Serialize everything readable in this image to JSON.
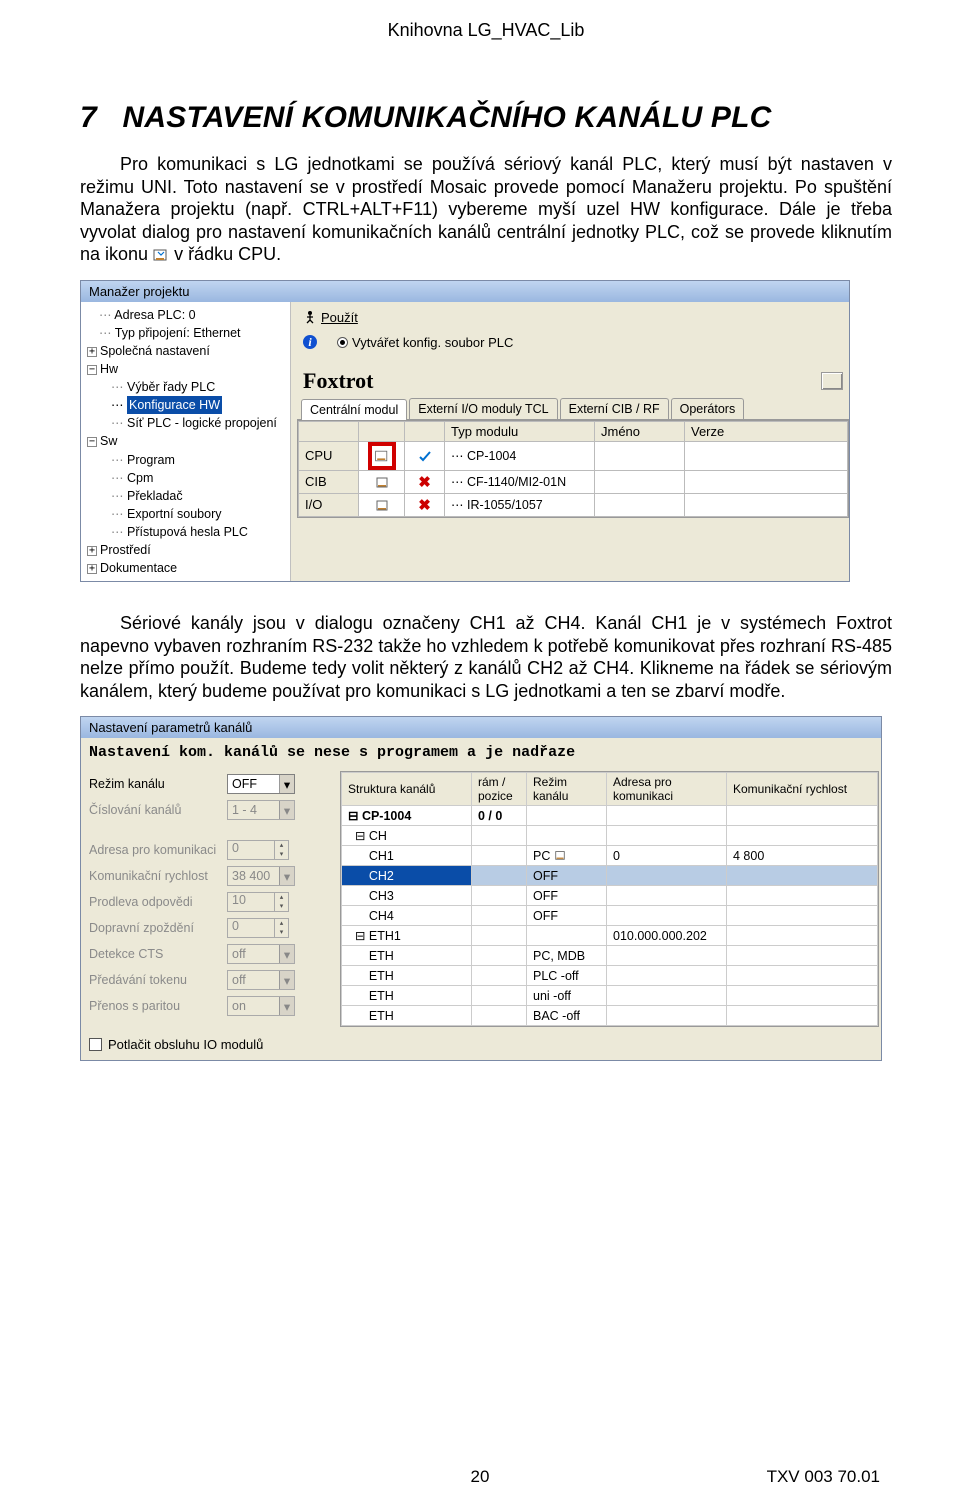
{
  "header": {
    "library_name": "Knihovna LG_HVAC_Lib"
  },
  "section": {
    "number": "7",
    "title": "NASTAVENÍ KOMUNIKAČNÍHO KANÁLU PLC",
    "p1": "Pro komunikaci s LG jednotkami se používá sériový kanál PLC, který musí být nastaven v režimu UNI. Toto nastavení se v prostředí Mosaic provede pomocí Manažeru projektu. Po spuštění Manažera projektu (např. CTRL+ALT+F11) vybereme myší uzel HW konfigurace. Dále je třeba vyvolat dialog pro nastavení komunikačních kanálů centrální jednotky PLC, což se provede kliknutím  na  ikonu ",
    "p1_after_icon": " v řádku CPU.",
    "p2": "Sériové kanály jsou v dialogu označeny CH1 až CH4. Kanál CH1 je v systémech Foxtrot napevno vybaven rozhraním RS-232 takže ho vzhledem k potřebě komunikovat přes rozhraní RS-485 nelze přímo použít. Budeme tedy volit některý z kanálů CH2 až CH4. Klikneme na řádek se sériovým kanálem, který budeme používat pro komunikaci s LG jednotkami a ten se zbarví modře."
  },
  "fig1": {
    "title": "Manažer projektu",
    "tree": {
      "addr": "Adresa PLC: 0",
      "conn": "Typ připojení: Ethernet",
      "common": "Společná nastavení",
      "hw": "Hw",
      "hw_sel": "Výběr řady PLC",
      "hw_konf": "Konfigurace HW",
      "hw_net": "Síť PLC - logické propojení",
      "sw": "Sw",
      "sw_prog": "Program",
      "sw_cpm": "Cpm",
      "sw_comp": "Překladač",
      "sw_exp": "Exportní soubory",
      "sw_pw": "Přístupová hesla PLC",
      "env": "Prostředí",
      "doc": "Dokumentace"
    },
    "toolbar": {
      "use_label": "Použít",
      "create_label": "Vytvářet konfig. soubor PLC"
    },
    "foxtrot_title": "Foxtrot",
    "tabs": [
      "Centrální modul",
      "Externí I/O moduly TCL",
      "Externí CIB / RF",
      "Operátors"
    ],
    "modtable": {
      "headers": {
        "blank": "",
        "typ": "Typ modulu",
        "jmeno": "Jméno",
        "verze": "Verze"
      },
      "rows": [
        {
          "label": "CPU",
          "mod": "CP-1004",
          "highlight": true
        },
        {
          "label": "CIB",
          "mod": "CF-1140/MI2-01N"
        },
        {
          "label": "I/O",
          "mod": "IR-1055/1057"
        }
      ]
    }
  },
  "fig2": {
    "title": "Nastavení parametrů kanálů",
    "banner": "Nastavení kom. kanálů se nese s programem a je nadřaze",
    "left": {
      "mode": {
        "label": "Režim kanálu",
        "value": "OFF"
      },
      "numbering": {
        "label": "Číslování kanálů",
        "value": "1 - 4"
      },
      "addr": {
        "label": "Adresa pro komunikaci",
        "value": "0"
      },
      "speed": {
        "label": "Komunikační rychlost",
        "value": "38 400"
      },
      "delay": {
        "label": "Prodleva odpovědi",
        "value": "10"
      },
      "transport": {
        "label": "Dopravní zpoždění",
        "value": "0"
      },
      "cts": {
        "label": "Detekce CTS",
        "value": "off"
      },
      "token": {
        "label": "Předávání tokenu",
        "value": "off"
      },
      "parity": {
        "label": "Přenos s paritou",
        "value": "on"
      }
    },
    "rtable": {
      "headers": {
        "struct": "Struktura kanálů",
        "pos": "rám / pozice",
        "mode": "Režim kanálu",
        "addr": "Adresa pro komunikaci",
        "speed": "Komunikační rychlost"
      },
      "rows": [
        {
          "struct": "⊟ CP-1004",
          "pos": "0 / 0",
          "mode": "",
          "addr": "",
          "speed": "",
          "bold": true
        },
        {
          "struct": "  ⊟ CH",
          "pos": "",
          "mode": "",
          "addr": "",
          "speed": ""
        },
        {
          "struct": "      CH1",
          "pos": "",
          "mode": "PC",
          "addr": "0",
          "speed": "4 800",
          "cfg": true
        },
        {
          "struct": "      CH2",
          "pos": "",
          "mode": "OFF",
          "addr": "",
          "speed": "",
          "selected": true
        },
        {
          "struct": "      CH3",
          "pos": "",
          "mode": "OFF",
          "addr": "",
          "speed": ""
        },
        {
          "struct": "      CH4",
          "pos": "",
          "mode": "OFF",
          "addr": "",
          "speed": ""
        },
        {
          "struct": "  ⊟ ETH1",
          "pos": "",
          "mode": "",
          "addr": "010.000.000.202",
          "speed": ""
        },
        {
          "struct": "      ETH",
          "pos": "",
          "mode": "PC, MDB",
          "addr": "",
          "speed": ""
        },
        {
          "struct": "      ETH",
          "pos": "",
          "mode": "PLC -off",
          "addr": "",
          "speed": ""
        },
        {
          "struct": "      ETH",
          "pos": "",
          "mode": "uni -off",
          "addr": "",
          "speed": ""
        },
        {
          "struct": "      ETH",
          "pos": "",
          "mode": "BAC -off",
          "addr": "",
          "speed": ""
        }
      ]
    },
    "checkbox_label": "Potlačit obsluhu IO modulů"
  },
  "footer": {
    "page": "20",
    "doc_id": "TXV 003 70.01"
  }
}
